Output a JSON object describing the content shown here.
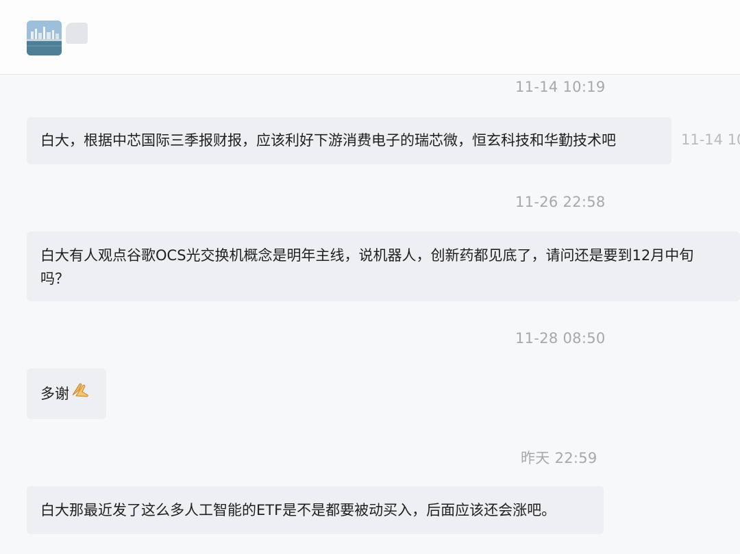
{
  "header": {
    "avatar_icon": "group-avatar-city-skyline",
    "name": ""
  },
  "messages": [
    {
      "time": "11-14 10:19",
      "text": "白大，根据中芯国际三季报财报，应该利好下游消费电子的瑞芯微，恒玄科技和华勤技术吧",
      "side_time": "11-14 10"
    },
    {
      "time": "11-26 22:58",
      "text_line1": "白大有人观点谷歌OCS光交换机概念是明年主线，说机器人，创新药都见底了，请问还是要到12月中旬",
      "text_line2": "吗？"
    },
    {
      "time": "11-28 08:50",
      "text": "多谢",
      "emoji_icon": "folded-hands-icon"
    },
    {
      "time": "昨天 22:59",
      "text": "白大那最近发了这么多人工智能的ETF是不是都要被动买入，后面应该还会涨吧。"
    }
  ],
  "colors": {
    "background": "#f7f8fa",
    "bubble": "#edeff3",
    "timestamp": "#a6a8ad"
  }
}
